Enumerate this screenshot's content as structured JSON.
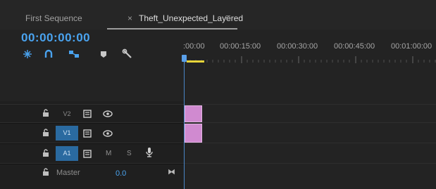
{
  "tabs": {
    "first": "First Sequence",
    "close_glyph": "×",
    "active": "Theft_Unexpected_Layered",
    "menu_glyph": "≡"
  },
  "timecode": "00:00:00:00",
  "tools": [
    "snap-icon",
    "magnet-icon",
    "linked-selection-icon",
    "marker-icon",
    "wrench-icon"
  ],
  "ruler": {
    "labels": [
      ":00:00",
      "00:00:15:00",
      "00:00:30:00",
      "00:00:45:00",
      "00:01:00:00"
    ]
  },
  "tracks": {
    "v2": {
      "lock": "🔒",
      "label": "V2",
      "sync_icon": "sync-lock-icon",
      "eye_icon": "eye-icon"
    },
    "v1": {
      "lock": "🔒",
      "label": "V1",
      "sync_icon": "sync-lock-icon",
      "eye_icon": "eye-icon"
    },
    "a1": {
      "lock": "🔒",
      "label": "A1",
      "mute": "M",
      "solo": "S",
      "mic_icon": "microphone-icon"
    },
    "master": {
      "lock": "🔒",
      "label": "Master",
      "value": "0.0",
      "icon": "⧓"
    }
  },
  "colors": {
    "accent": "#4aa3ef",
    "clip": "#d08ad0",
    "work_area": "#e8d53a",
    "selected_track": "#2a6aa0"
  }
}
